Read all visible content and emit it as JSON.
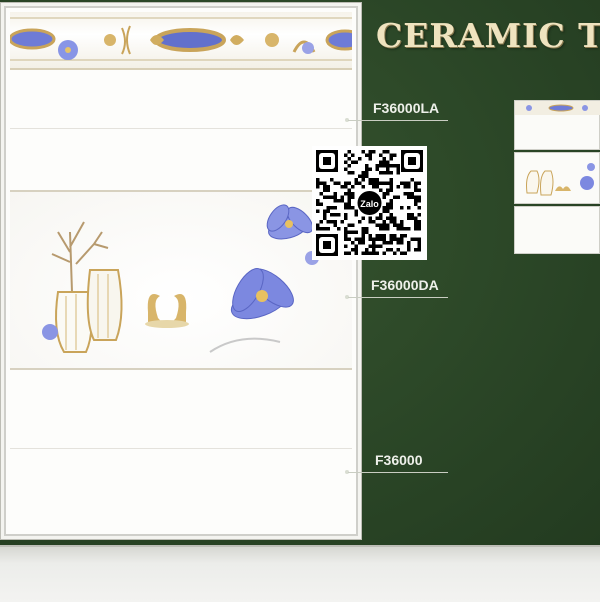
{
  "title": "CERAMIC TI",
  "labels": {
    "la": "F36000LA",
    "da": "F36000DA",
    "plain": "F36000"
  },
  "qr": {
    "badge": "Zalo"
  },
  "colors": {
    "wall": "#2e4a2a",
    "tile": "#fdfdfb",
    "flower_blue": "#6b79d8",
    "gold": "#c9a45a"
  }
}
